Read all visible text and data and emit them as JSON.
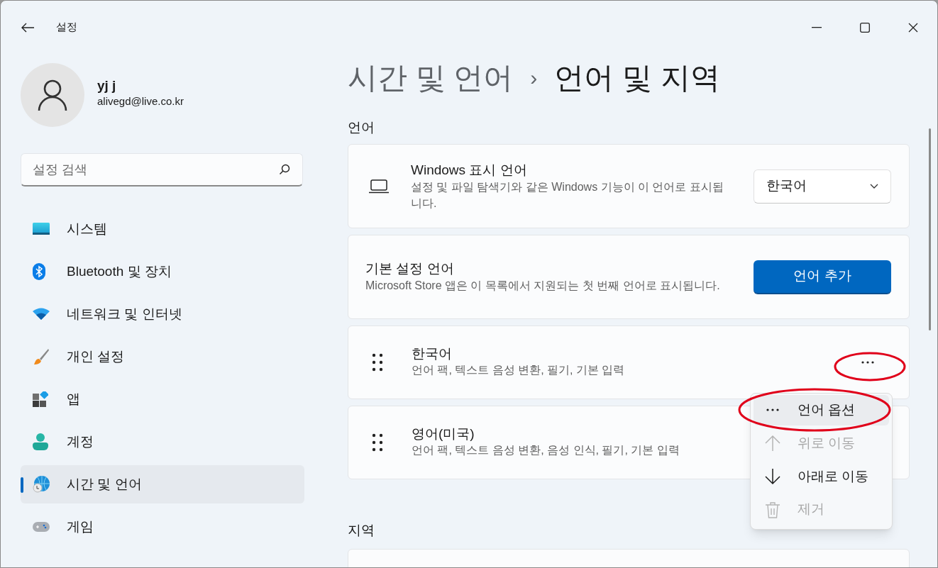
{
  "window": {
    "title": "설정"
  },
  "user": {
    "name": "yj j",
    "email": "alivegd@live.co.kr"
  },
  "search": {
    "placeholder": "설정 검색"
  },
  "sidebar": {
    "items": [
      {
        "label": "시스템",
        "kind": "system",
        "selected": false
      },
      {
        "label": "Bluetooth 및 장치",
        "kind": "bluetooth",
        "selected": false
      },
      {
        "label": "네트워크 및 인터넷",
        "kind": "network",
        "selected": false
      },
      {
        "label": "개인 설정",
        "kind": "brush",
        "selected": false
      },
      {
        "label": "앱",
        "kind": "apps",
        "selected": false
      },
      {
        "label": "계정",
        "kind": "account",
        "selected": false
      },
      {
        "label": "시간 및 언어",
        "kind": "time",
        "selected": true
      },
      {
        "label": "게임",
        "kind": "game",
        "selected": false
      }
    ]
  },
  "breadcrumb": {
    "parent": "시간 및 언어",
    "separator": "›",
    "current": "언어 및 지역"
  },
  "language_section": {
    "heading": "언어",
    "display_language": {
      "title": "Windows 표시 언어",
      "description": "설정 및 파일 탐색기와 같은 Windows 기능이 이 언어로 표시됩니다.",
      "dropdown_value": "한국어"
    },
    "preferred": {
      "title": "기본 설정 언어",
      "description": "Microsoft Store 앱은 이 목록에서 지원되는 첫 번째 언어로 표시됩니다.",
      "button": "언어 추가"
    },
    "languages": [
      {
        "name": "한국어",
        "features": "언어 팩, 텍스트 음성 변환, 필기, 기본 입력"
      },
      {
        "name": "영어(미국)",
        "features": "언어 팩, 텍스트 음성 변환, 음성 인식, 필기, 기본 입력"
      }
    ]
  },
  "context_menu": {
    "items": [
      {
        "label": "언어 옵션",
        "kind": "more",
        "disabled": false,
        "selected": true
      },
      {
        "label": "위로 이동",
        "kind": "up",
        "disabled": true,
        "selected": false
      },
      {
        "label": "아래로 이동",
        "kind": "down",
        "disabled": false,
        "selected": false
      },
      {
        "label": "제거",
        "kind": "delete",
        "disabled": true,
        "selected": false
      }
    ]
  },
  "region_section": {
    "heading": "지역"
  }
}
